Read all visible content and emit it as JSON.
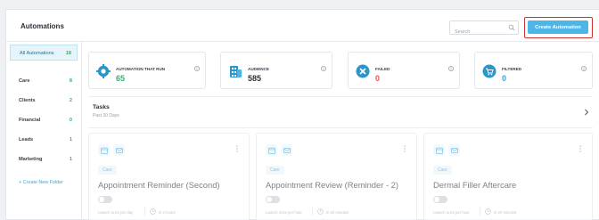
{
  "header": {
    "title": "Automations",
    "search_placeholder": "Search",
    "create_label": "Create Automation"
  },
  "sidebar": {
    "folders": [
      {
        "label": "All Automations",
        "count": "18"
      },
      {
        "label": "Care",
        "count": "8"
      },
      {
        "label": "Clients",
        "count": "2"
      },
      {
        "label": "Financial",
        "count": "0"
      },
      {
        "label": "Leads",
        "count": "1"
      },
      {
        "label": "Marketing",
        "count": "1"
      }
    ],
    "new_folder": "+ Create New Folder"
  },
  "stats": [
    {
      "label": "AUTOMATION THAT RUN",
      "value": "65",
      "color": "#35b26f",
      "icon": "gear-icon"
    },
    {
      "label": "AUDIENCE",
      "value": "585",
      "color": "#2b2f36",
      "icon": "building-icon"
    },
    {
      "label": "FAILED",
      "value": "0",
      "color": "#e0544f",
      "icon": "x-circle-icon"
    },
    {
      "label": "FILTERED",
      "value": "0",
      "color": "#3ba4d8",
      "icon": "cart-icon"
    }
  ],
  "tasks": {
    "title": "Tasks",
    "subtitle": "Past 30 Days"
  },
  "cards": [
    {
      "tag": "Care",
      "title": "Appointment Reminder (Second)",
      "last_run": "Launch once per day",
      "eta": "In 2 hours"
    },
    {
      "tag": "Care",
      "title": "Appointment Review (Reminder - 2)",
      "last_run": "Launch once per hour",
      "eta": "In 20 minutes"
    },
    {
      "tag": "Care",
      "title": "Dermal Filler Aftercare",
      "last_run": "Launch once per hour",
      "eta": "In 20 minutes"
    }
  ],
  "colors": {
    "accent": "#4eb6e6",
    "highlight_border": "#d2302c",
    "count_green": "#35b26f"
  }
}
